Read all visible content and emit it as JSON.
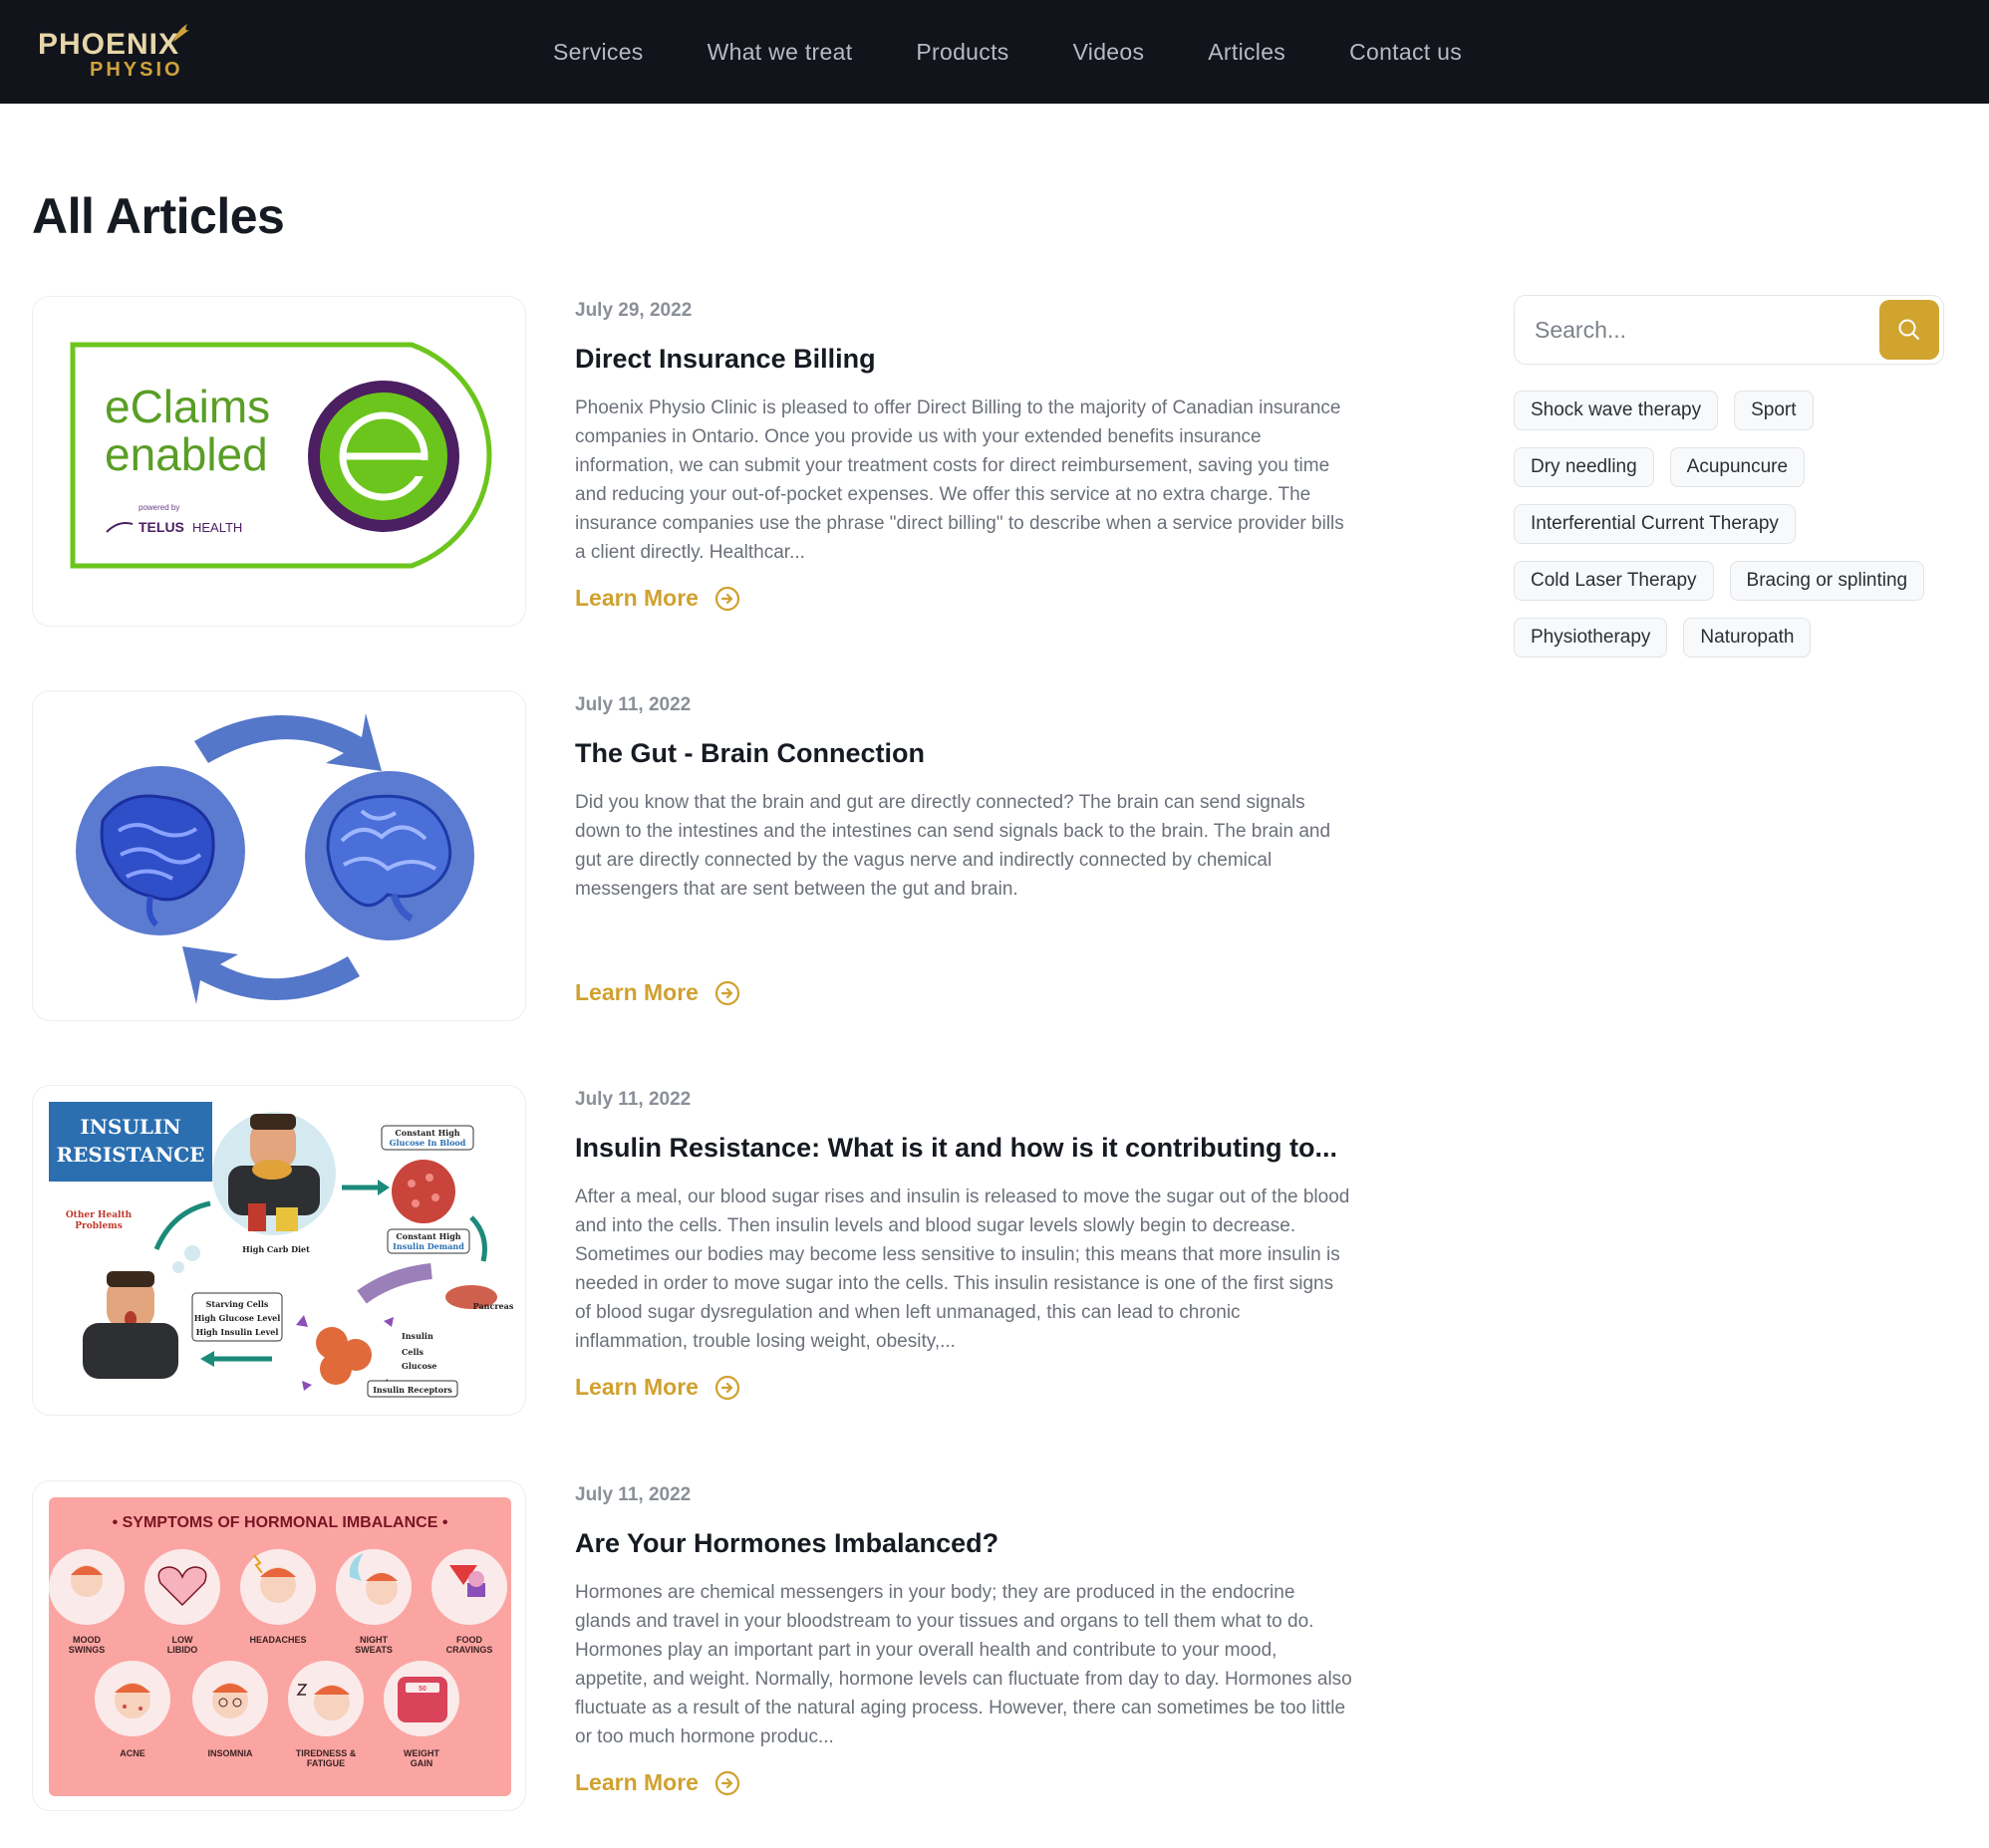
{
  "brand": {
    "line1": "PHOENIX",
    "line2": "PHYSIO"
  },
  "nav": [
    {
      "label": "Services"
    },
    {
      "label": "What we treat"
    },
    {
      "label": "Products"
    },
    {
      "label": "Videos"
    },
    {
      "label": "Articles"
    },
    {
      "label": "Contact us"
    }
  ],
  "page_title": "All Articles",
  "articles": [
    {
      "date": "July 29, 2022",
      "title": "Direct Insurance Billing",
      "excerpt": "Phoenix Physio Clinic is pleased to offer Direct Billing to the majority of Canadian insurance companies in Ontario. Once you provide us with your extended benefits insurance information, we can submit your treatment costs for direct reimbursement, saving you time and reducing your out-of-pocket expenses. We offer this service at no extra charge. The insurance companies use the phrase \"direct billing\" to describe when a service provider bills a client directly. Healthcar...",
      "cta": "Learn More",
      "image": {
        "line1": "eClaims",
        "line2": "enabled",
        "powered": "powered by",
        "brand": "TELUS",
        "brand_suffix": "HEALTH"
      }
    },
    {
      "date": "July 11, 2022",
      "title": "The Gut - Brain Connection",
      "excerpt": "Did you know that the brain and gut are directly connected? The brain can send signals down to the intestines and the intestines can send signals back to the brain. The brain and gut are directly connected by the vagus nerve and indirectly connected by chemical messengers that are sent between the gut and brain.",
      "cta": "Learn More"
    },
    {
      "date": "July 11, 2022",
      "title": "Insulin Resistance: What is it and how is it contributing to...",
      "excerpt": "After a meal, our blood sugar rises and insulin is released to move the sugar out of the blood and into the cells. Then insulin levels and blood sugar levels slowly begin to decrease. Sometimes our bodies may become less sensitive to insulin; this means that more insulin is needed in order to move sugar into the cells. This insulin resistance is one of the first signs of blood sugar dysregulation and when left unmanaged, this can lead to chronic inflammation, trouble losing weight, obesity,...",
      "cta": "Learn More",
      "image": {
        "heading1": "INSULIN",
        "heading2": "RESISTANCE",
        "labels": {
          "high_carb": "High Carb Diet",
          "glucose1": "Constant High",
          "glucose2": "Glucose In Blood",
          "insulin1": "Constant High",
          "insulin2": "Insulin Demand",
          "other1": "Other Health",
          "other2": "Problems",
          "starving1": "Starving Cells",
          "starving2": "High Glucose Level",
          "starving3": "High Insulin Level",
          "pancreas": "Pancreas",
          "insulin": "Insulin",
          "cells": "Cells",
          "glucose": "Glucose",
          "receptors": "Insulin Receptors"
        }
      }
    },
    {
      "date": "July 11, 2022",
      "title": "Are Your Hormones Imbalanced?",
      "excerpt": "Hormones are chemical messengers in your body; they are produced in the endocrine glands and travel in your bloodstream to your tissues and organs to tell them what to do. Hormones play an important part in your overall health and contribute to your mood, appetite, and weight. Normally, hormone levels can fluctuate from day to day. Hormones also fluctuate as a result of the natural aging process. However, there can sometimes be too little or too much hormone produc...",
      "cta": "Learn More",
      "image": {
        "heading": "• SYMPTOMS OF HORMONAL IMBALANCE •",
        "row1": [
          {
            "l1": "MOOD",
            "l2": "SWINGS"
          },
          {
            "l1": "LOW",
            "l2": "LIBIDO"
          },
          {
            "l1": "HEADACHES",
            "l2": ""
          },
          {
            "l1": "NIGHT",
            "l2": "SWEATS"
          },
          {
            "l1": "FOOD",
            "l2": "CRAVINGS"
          }
        ],
        "row2": [
          {
            "l1": "ACNE",
            "l2": ""
          },
          {
            "l1": "INSOMNIA",
            "l2": ""
          },
          {
            "l1": "TIREDNESS &",
            "l2": "FATIGUE"
          },
          {
            "l1": "WEIGHT",
            "l2": "GAIN"
          }
        ],
        "scale": "50"
      }
    }
  ],
  "sidebar": {
    "search_placeholder": "Search...",
    "tags": [
      "Shock wave therapy",
      "Sport",
      "Dry needling",
      "Acupuncure",
      "Interferential Current Therapy",
      "Cold Laser Therapy",
      "Bracing or splinting",
      "Physiotherapy",
      "Naturopath"
    ]
  },
  "colors": {
    "header_bg": "#11141b",
    "accent": "#d0a12f",
    "eclaims_green": "#6cc51c",
    "eclaims_purple": "#4b1f61",
    "gut_blue": "#5577c9",
    "insulin_heading": "#2b6fb1",
    "hormone_bg": "#fba5a2"
  },
  "icons": {
    "search": "search-icon",
    "learn_more": "arrow-circle-right-icon"
  }
}
